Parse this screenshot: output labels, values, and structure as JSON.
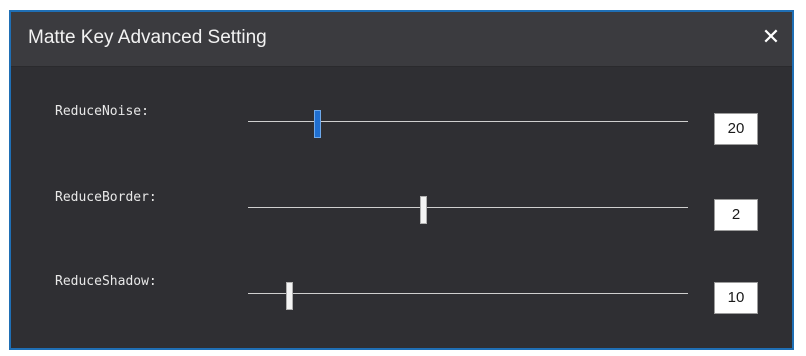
{
  "window": {
    "title": "Matte Key Advanced Setting",
    "close_icon": "close-icon",
    "border_color": "#1f6fb5",
    "background_color": "#2f2f33"
  },
  "settings": [
    {
      "label": "ReduceNoise:",
      "value": "20",
      "level": 0.16,
      "active": true
    },
    {
      "label": "ReduceBorder:",
      "value": "2",
      "level": 0.4,
      "active": false
    },
    {
      "label": "ReduceShadow:",
      "value": "10",
      "level": 0.095,
      "active": false
    }
  ]
}
